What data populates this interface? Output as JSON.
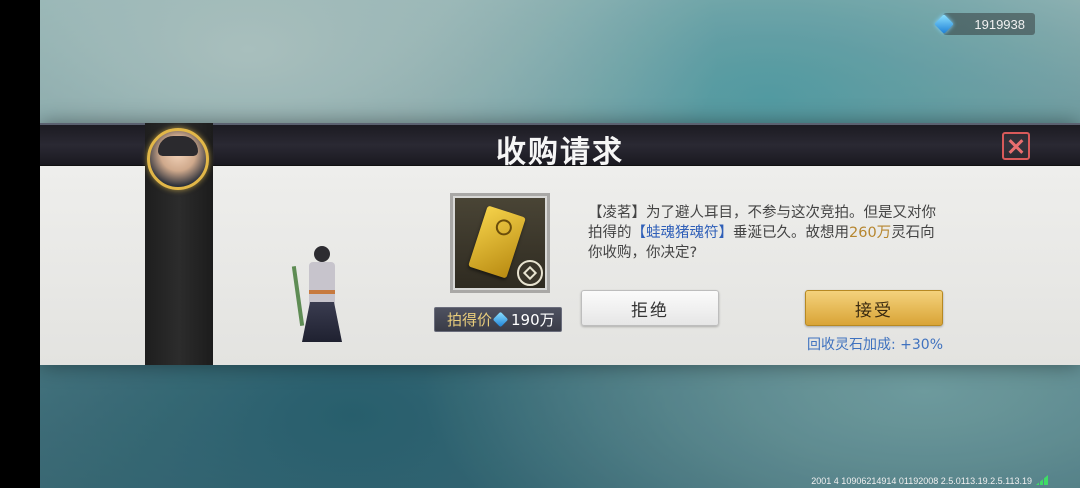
{
  "currency": {
    "icon": "spirit-stone-gem-icon",
    "amount": "1919938"
  },
  "dialog": {
    "title": "收购请求",
    "close_icon": "close-icon",
    "npc_avatar": "npc-portrait-icon",
    "item": {
      "icon": "toad-pig-soul-talisman-icon",
      "rank_icon": "item-rank-badge-icon"
    },
    "price": {
      "label": "拍得价",
      "icon": "spirit-stone-gem-icon",
      "value": "190万"
    },
    "message": {
      "speaker": "【凌茗】",
      "part1": "为了避人耳目，不参与这次竞拍。但是又对你拍得的",
      "item_name": "【蛙魂猪魂符】",
      "part2": "垂涎已久。故想用",
      "offer": "260万",
      "part3": "灵石向你收购，你决定?"
    },
    "reject_label": "拒绝",
    "accept_label": "接受",
    "bonus_text": "回收灵石加成: +30%"
  },
  "footer": {
    "build_info": "2001 4 10906214914 01192008 2.5.0113.19.2.5.113.19"
  },
  "colors": {
    "accept": "#d9a437",
    "highlight_blue": "#2f5fb8",
    "highlight_gold": "#b6862f",
    "bonus": "#3f72bf"
  }
}
